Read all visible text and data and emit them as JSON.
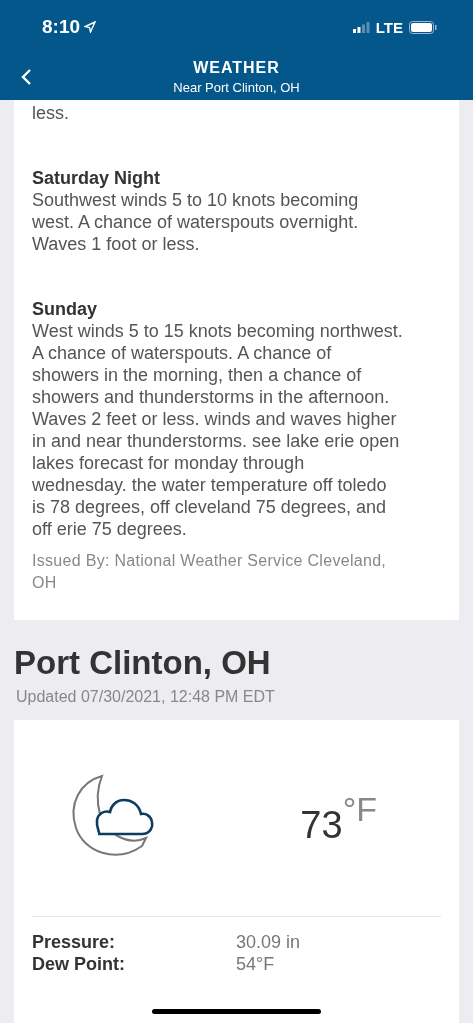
{
  "status_bar": {
    "time": "8:10",
    "network": "LTE"
  },
  "header": {
    "title": "WEATHER",
    "subtitle": "Near Port Clinton, OH"
  },
  "forecast": {
    "lead_text": "less.",
    "periods": [
      {
        "name": "Saturday Night",
        "text": "Southwest winds 5 to 10 knots becoming west. A chance of waterspouts overnight. Waves 1 foot or less."
      },
      {
        "name": "Sunday",
        "text": "West winds 5 to 15 knots becoming northwest. A chance of waterspouts. A chance of showers in the morning, then a chance of showers and thunderstorms in the afternoon. Waves 2 feet or less. winds and waves higher in and near thunderstorms. see lake erie open lakes forecast for monday through wednesday. the water temperature off toledo is 78 degrees, off cleveland 75 degrees, and off erie 75 degrees."
      }
    ],
    "issued_by": "Issued By: National Weather Service Cleveland, OH"
  },
  "location": {
    "name": "Port Clinton, OH",
    "updated": "Updated 07/30/2021, 12:48 PM EDT"
  },
  "conditions": {
    "temperature": "73",
    "unit": "°F",
    "details": [
      {
        "label": "Pressure:",
        "value": "30.09 in"
      },
      {
        "label": "Dew Point:",
        "value": "54°F"
      }
    ]
  }
}
